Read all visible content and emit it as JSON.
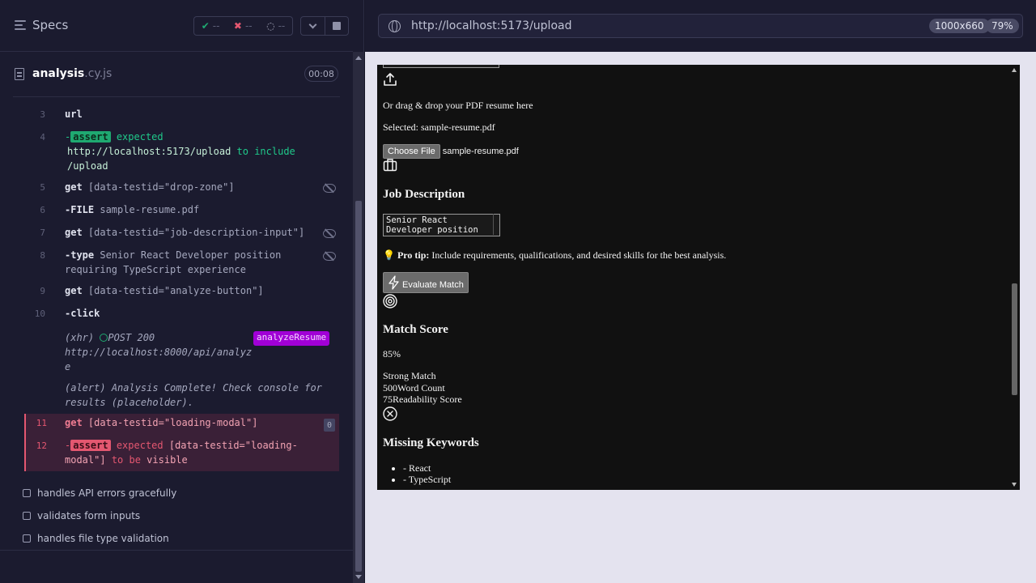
{
  "runner": {
    "specs_label": "Specs",
    "stats": {
      "passed": "--",
      "failed": "--",
      "pending": "--"
    },
    "spec_file": {
      "name": "analysis",
      "ext": ".cy.js",
      "duration": "00:08"
    },
    "commands": [
      {
        "num": "3",
        "name": "url"
      },
      {
        "num": "4",
        "prefix": "-",
        "tag": "assert",
        "text_expected": "expected",
        "value": "http://localhost:5173/upload",
        "text_include": "to include",
        "value2": "/upload"
      },
      {
        "num": "5",
        "name": "get",
        "selector": "[data-testid=\"drop-zone\"]"
      },
      {
        "num": "6",
        "name": "-FILE",
        "arg": "sample-resume.pdf"
      },
      {
        "num": "7",
        "name": "get",
        "selector": "[data-testid=\"job-description-input\"]"
      },
      {
        "num": "8",
        "name": "-type",
        "arg_line1": "Senior React Developer position",
        "arg_line2": "requiring TypeScript experience"
      },
      {
        "num": "9",
        "name": "get",
        "selector": "[data-testid=\"analyze-button\"]"
      },
      {
        "num": "10",
        "name": "-click"
      }
    ],
    "xhr": {
      "label": "(xhr)",
      "status": "POST 200",
      "url_line1": "http://localhost:8000/api/analyz",
      "url_line2": "e",
      "alias": "analyzeResume"
    },
    "alert": {
      "label": "(alert)",
      "line1": "Analysis Complete! Check console for",
      "line2": "results (placeholder)."
    },
    "failed_commands": [
      {
        "num": "11",
        "name": "get",
        "selector": "[data-testid=\"loading-modal\"]",
        "count": "0"
      },
      {
        "num": "12",
        "prefix": "-",
        "tag": "assert",
        "text_expected": "expected",
        "selector_line1": "[data-testid=\"loading-",
        "selector_line2": "modal\"]",
        "text_tobe": "to be",
        "text_visible": "visible"
      }
    ],
    "tests": [
      "handles API errors gracefully",
      "validates form inputs",
      "handles file type validation"
    ]
  },
  "browser": {
    "url": "http://localhost:5173/upload",
    "viewport": "1000x660",
    "zoom": "79%"
  },
  "app": {
    "drag_text": "Or drag & drop your PDF resume here",
    "selected_text": "Selected: sample-resume.pdf",
    "choose_file_label": "Choose File",
    "chosen_file": "sample-resume.pdf",
    "job_desc_heading": "Job Description",
    "job_desc_value": "Senior React\nDeveloper position",
    "pro_tip_label": "Pro tip:",
    "pro_tip_text": " Include requirements, qualifications, and desired skills for the best analysis.",
    "evaluate_label": "Evaluate Match",
    "match_heading": "Match Score",
    "match_value": "85%",
    "match_strength": "Strong Match",
    "word_count_value": "500",
    "word_count_label": "Word Count",
    "readability_value": "75",
    "readability_label": "Readability Score",
    "missing_heading": "Missing Keywords",
    "missing_keywords": [
      "- React",
      "- TypeScript"
    ]
  }
}
